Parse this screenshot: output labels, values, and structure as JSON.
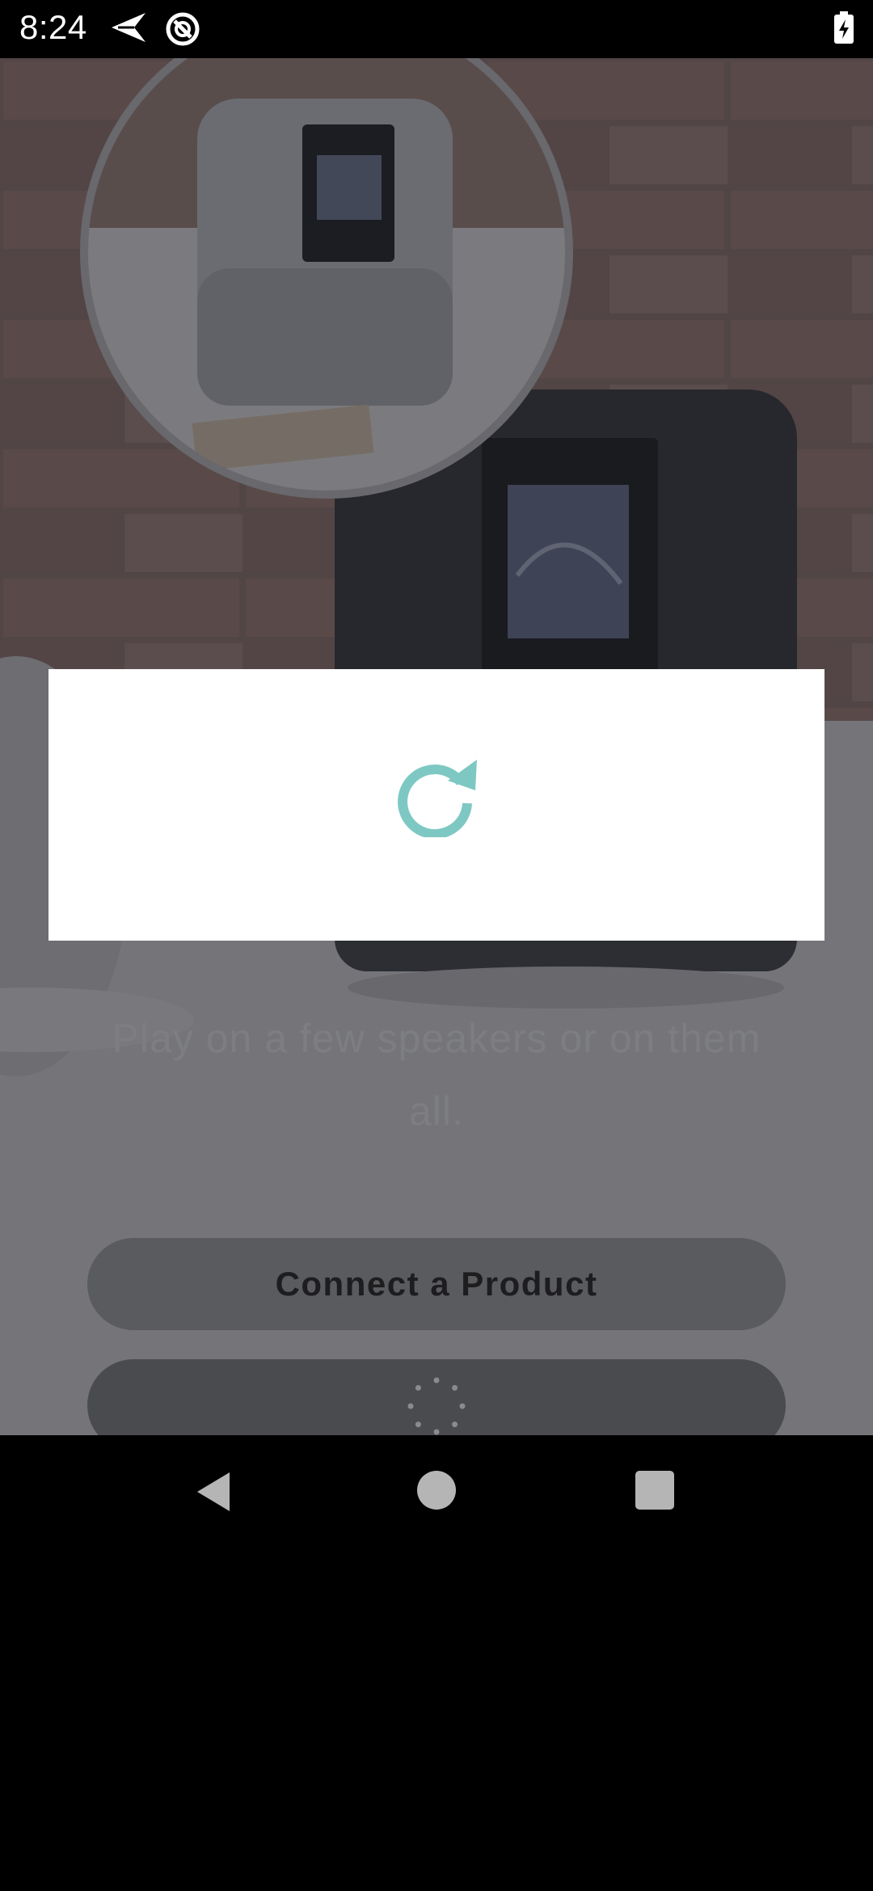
{
  "status_bar": {
    "time": "8:24",
    "icons": [
      "send-icon",
      "circle-icon",
      "battery-charging-icon"
    ]
  },
  "main": {
    "tagline": "Play on a few speakers or on them all.",
    "connect_button_label": "Connect a Product",
    "secondary_button_state": "loading"
  },
  "dialog": {
    "icon": "refresh-icon",
    "icon_color": "#7ec8c3"
  },
  "nav_bar": {
    "buttons": [
      "back",
      "home",
      "recents"
    ]
  },
  "colors": {
    "accent": "#7ec8c3",
    "overlay": "#232328"
  }
}
